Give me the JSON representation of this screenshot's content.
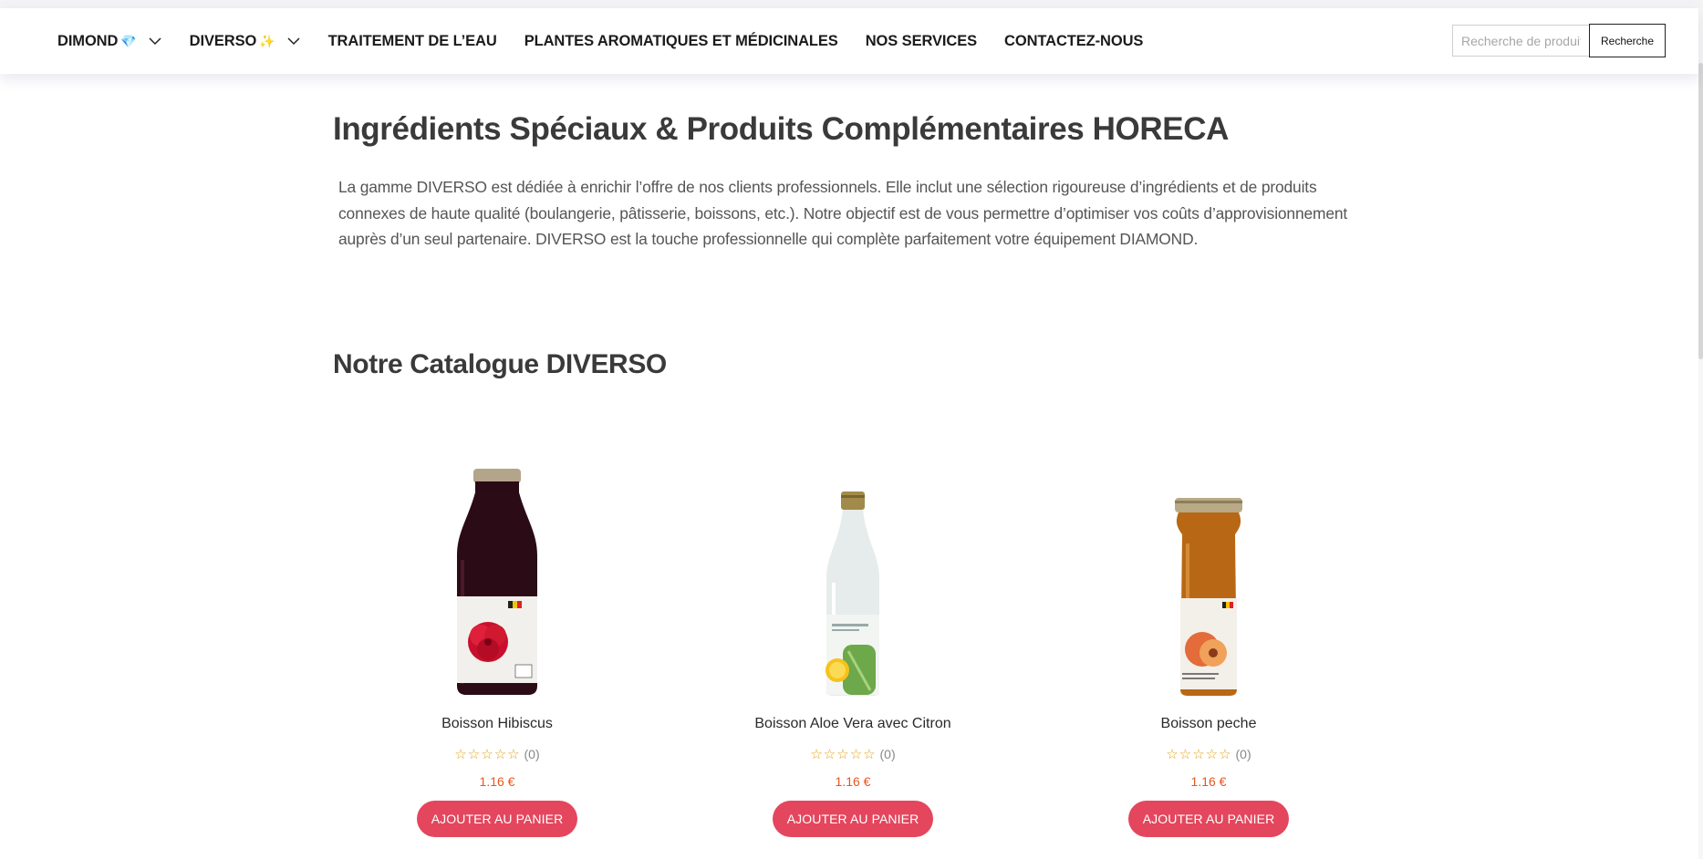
{
  "nav": {
    "items": [
      {
        "label": "DIMOND",
        "emoji": "💎",
        "has_dropdown": true
      },
      {
        "label": "DIVERSO",
        "emoji": "✨",
        "has_dropdown": true
      },
      {
        "label": "TRAITEMENT DE L’EAU",
        "emoji": "",
        "has_dropdown": false
      },
      {
        "label": "PLANTES AROMATIQUES ET MÉDICINALES",
        "emoji": "",
        "has_dropdown": false
      },
      {
        "label": "NOS SERVICES",
        "emoji": "",
        "has_dropdown": false
      },
      {
        "label": "CONTACTEZ-NOUS",
        "emoji": "",
        "has_dropdown": false
      }
    ]
  },
  "search": {
    "placeholder": "Recherche de produits",
    "button_label": "Recherche"
  },
  "page": {
    "title": "Ingrédients Spéciaux & Produits Complémentaires HORECA",
    "intro": "La gamme DIVERSO est dédiée à enrichir l’offre de nos clients professionnels. Elle inclut une sélection rigoureuse d’ingrédients et de produits connexes de haute qualité (boulangerie, pâtisserie, boissons, etc.). Notre objectif est de vous permettre d’optimiser vos coûts d’approvisionnement auprès d’un seul partenaire. DIVERSO est la touche professionnelle qui complète parfaitement votre équipement DIAMOND.",
    "catalog_title": "Notre Catalogue DIVERSO"
  },
  "products": [
    {
      "name": "Boisson Hibiscus",
      "stars": "☆☆☆☆☆",
      "rating_count": "(0)",
      "price": "1.16 €",
      "cart_label": "AJOUTER AU PANIER",
      "image_icon": "hibiscus-bottle"
    },
    {
      "name": "Boisson Aloe Vera avec Citron",
      "stars": "☆☆☆☆☆",
      "rating_count": "(0)",
      "price": "1.16 €",
      "cart_label": "AJOUTER AU PANIER",
      "image_icon": "aloe-vera-bottle"
    },
    {
      "name": "Boisson peche",
      "stars": "☆☆☆☆☆",
      "rating_count": "(0)",
      "price": "1.16 €",
      "cart_label": "AJOUTER AU PANIER",
      "image_icon": "peach-bottle"
    }
  ],
  "colors": {
    "accent_button": "#e4465d",
    "price": "#e8561e",
    "stars": "#e3a11a"
  }
}
